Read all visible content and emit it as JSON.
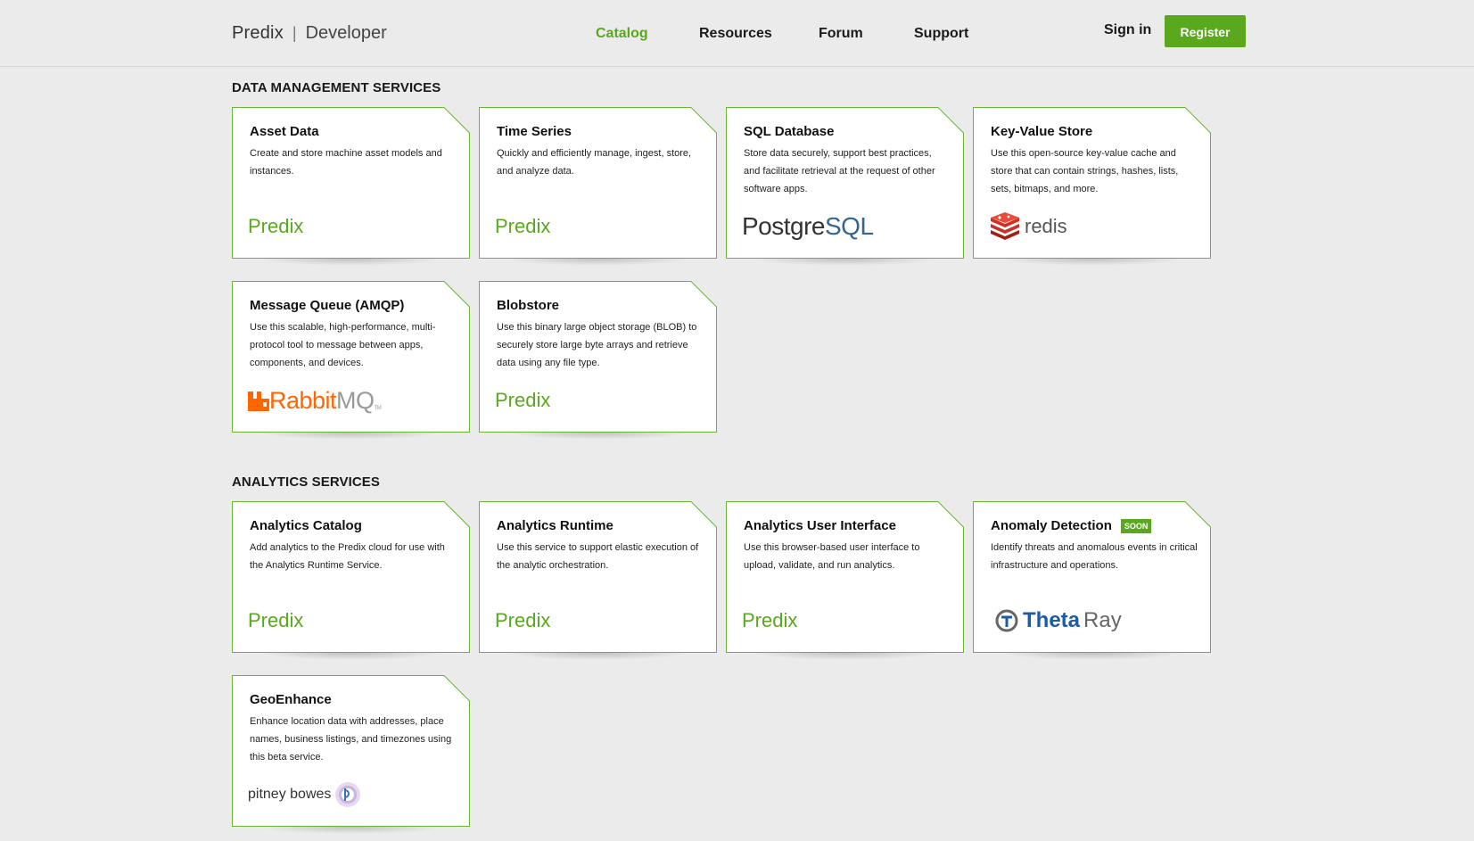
{
  "brand": {
    "name": "Predix",
    "separator": "|",
    "product": "Developer"
  },
  "nav": {
    "items": [
      {
        "label": "Catalog",
        "active": true
      },
      {
        "label": "Resources",
        "active": false
      },
      {
        "label": "Forum",
        "active": false
      },
      {
        "label": "Support",
        "active": false
      }
    ],
    "signin_label": "Sign in",
    "register_label": "Register"
  },
  "colors": {
    "accent": "#5aa81d",
    "background": "#ebebeb",
    "card_border": "#6bb536"
  },
  "sections": [
    {
      "title": "DATA MANAGEMENT SERVICES",
      "cards": [
        {
          "title": "Asset Data",
          "description": "Create and store machine asset models and instances.",
          "logo": "Predix"
        },
        {
          "title": "Time Series",
          "description": "Quickly and efficiently manage, ingest, store, and analyze data.",
          "logo": "Predix"
        },
        {
          "title": "SQL Database",
          "description": "Store data securely, support best practices, and facilitate retrieval at the request of other software apps.",
          "logo_text_a": "Postgre",
          "logo_text_b": "SQL"
        },
        {
          "title": "Key-Value Store",
          "description": "Use this open-source key-value cache and store that can contain strings, hashes, lists, sets, bitmaps, and more.",
          "logo": "redis"
        },
        {
          "title": "Message Queue (AMQP)",
          "description": "Use this scalable, high-performance, multi-protocol tool to message between apps, components, and devices.",
          "logo_text_a": "Rabbit",
          "logo_text_b": "MQ",
          "logo_tm": "TM"
        },
        {
          "title": "Blobstore",
          "description": "Use this binary large object storage (BLOB) to securely store large byte arrays and retrieve data using any file type.",
          "logo": "Predix"
        }
      ]
    },
    {
      "title": "ANALYTICS SERVICES",
      "cards": [
        {
          "title": "Analytics Catalog",
          "description": "Add analytics to the Predix cloud for use with the Analytics Runtime Service.",
          "logo": "Predix"
        },
        {
          "title": "Analytics Runtime",
          "description": "Use this service to support elastic execution of the analytic orchestration.",
          "logo": "Predix"
        },
        {
          "title": "Analytics User Interface",
          "description": "Use this browser-based user interface to upload, validate, and run analytics.",
          "logo": "Predix"
        },
        {
          "title": "Anomaly Detection",
          "badge": "SOON",
          "description": "Identify threats and anomalous events in critical infrastructure and operations.",
          "logo_text_a": "Theta",
          "logo_text_b": "Ray"
        },
        {
          "title": "GeoEnhance",
          "description": "Enhance location data with addresses, place names, business listings, and timezones using this beta service.",
          "logo": "pitney bowes"
        }
      ]
    }
  ]
}
